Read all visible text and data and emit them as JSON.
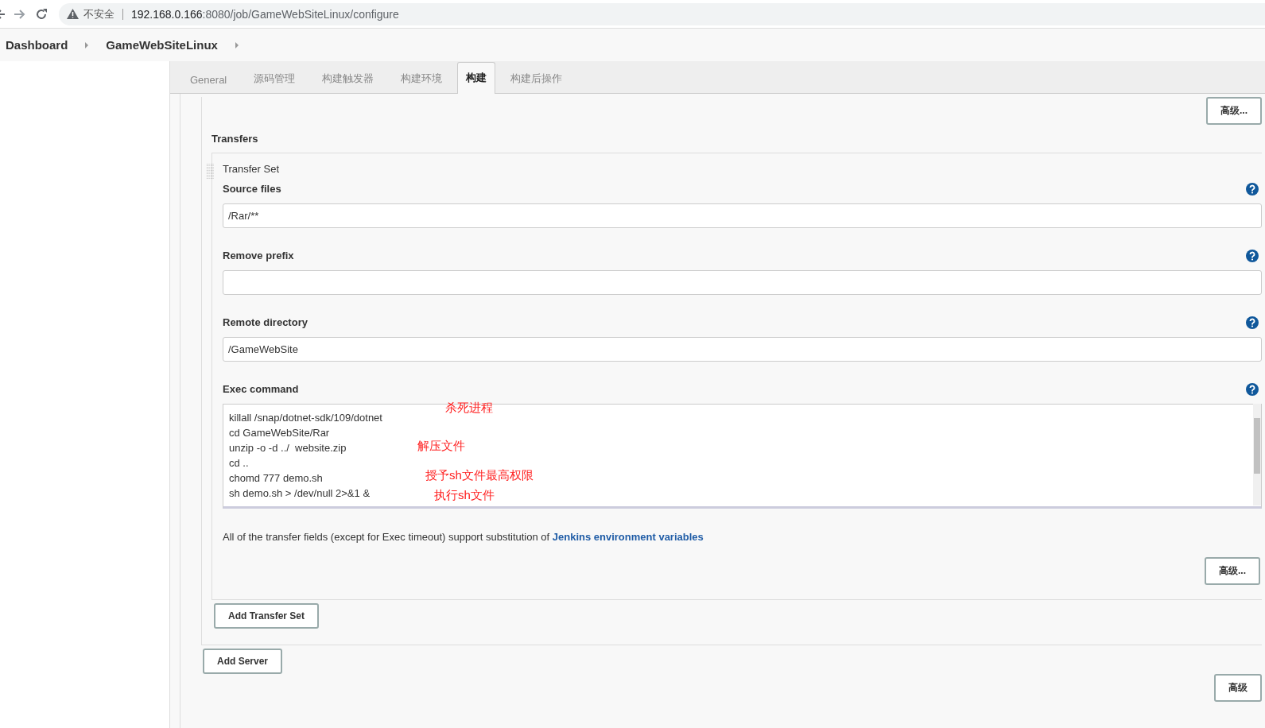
{
  "browser": {
    "security_label": "不安全",
    "url_host": "192.168.0.166",
    "url_rest": ":8080/job/GameWebSiteLinux/configure"
  },
  "breadcrumbs": [
    "Dashboard",
    "GameWebSiteLinux"
  ],
  "tabs": [
    {
      "label": "General",
      "selected": false
    },
    {
      "label": "源码管理",
      "selected": false
    },
    {
      "label": "构建触发器",
      "selected": false
    },
    {
      "label": "构建环境",
      "selected": false
    },
    {
      "label": "构建",
      "selected": true
    },
    {
      "label": "构建后操作",
      "selected": false
    }
  ],
  "top_advanced_button": "高级...",
  "transfers": {
    "title": "Transfers",
    "transfer_set": {
      "title": "Transfer Set",
      "fields": [
        {
          "kind": "input",
          "label": "Source files",
          "value": "/Rar/**"
        },
        {
          "kind": "input",
          "label": "Remove prefix"
        },
        {
          "kind": "input",
          "label": "Remote directory",
          "value": "/GameWebSite"
        },
        {
          "kind": "textarea",
          "label": "Exec command",
          "lines": [
            "killall /snap/dotnet-sdk/109/dotnet",
            "cd GameWebSite/Rar",
            "unzip -o -d ../  website.zip",
            "cd ..",
            "chomd 777 demo.sh",
            "sh demo.sh > /dev/null 2>&1 &"
          ],
          "annotations": [
            "杀死进程",
            "解压文件",
            "授予sh文件最高权限",
            "执行sh文件"
          ]
        }
      ],
      "note": "All of the transfer fields (except for Exec timeout) support substitution of",
      "note_link": "Jenkins environment variables",
      "advanced_button": "高级..."
    },
    "add_transfer_set_button": "Add Transfer Set"
  },
  "add_server_button": "Add Server",
  "bottom_advanced_button": "高级"
}
